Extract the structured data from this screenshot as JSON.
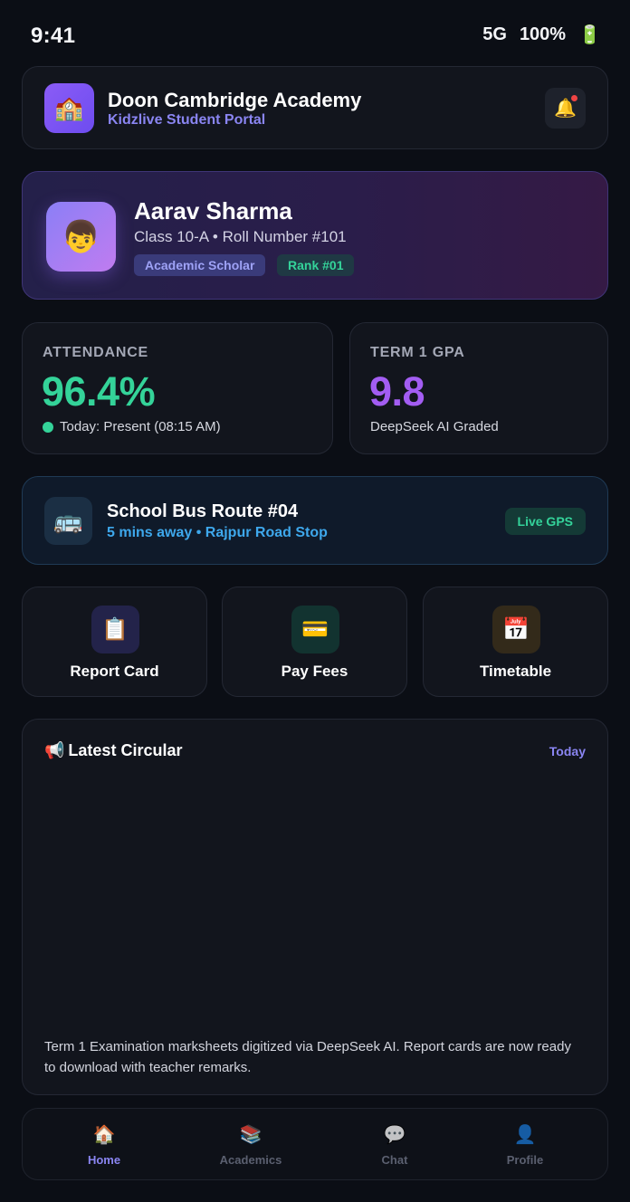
{
  "status_bar": {
    "time": "9:41",
    "network": "5G",
    "battery": "100%",
    "battery_icon": "🔋"
  },
  "header": {
    "logo_icon": "🏫",
    "school_name": "Doon Cambridge Academy",
    "portal_name": "Kidzlive Student Portal",
    "bell_icon": "🔔"
  },
  "profile": {
    "avatar_icon": "👦",
    "name": "Aarav Sharma",
    "class_info": "Class 10-A • Roll Number #101",
    "badges": [
      "Academic Scholar",
      "Rank #01"
    ]
  },
  "stats": {
    "attendance": {
      "label": "ATTENDANCE",
      "value": "96.4%",
      "sub": "Today: Present (08:15 AM)"
    },
    "gpa": {
      "label": "TERM 1 GPA",
      "value": "9.8",
      "sub": "DeepSeek AI Graded"
    }
  },
  "bus": {
    "icon": "🚌",
    "title": "School Bus Route #04",
    "subtitle": "5 mins away • Rajpur Road Stop",
    "badge": "Live GPS"
  },
  "actions": [
    {
      "icon": "📋",
      "label": "Report Card"
    },
    {
      "icon": "💳",
      "label": "Pay Fees"
    },
    {
      "icon": "📅",
      "label": "Timetable"
    }
  ],
  "circular": {
    "icon": "📢",
    "title": "Latest Circular",
    "date": "Today",
    "body": "Term 1 Examination marksheets digitized via DeepSeek AI. Report cards are now ready to download with teacher remarks."
  },
  "nav": {
    "items": [
      {
        "icon": "🏠",
        "label": "Home"
      },
      {
        "icon": "📚",
        "label": "Academics"
      },
      {
        "icon": "💬",
        "label": "Chat"
      },
      {
        "icon": "👤",
        "label": "Profile"
      }
    ],
    "active": "Home"
  },
  "colors": {
    "background": "#0b0e15",
    "accent_purple": "#8a85f2",
    "accent_green": "#34d399",
    "gpa_purple": "#a35df2",
    "bus_blue": "#3ea8ec"
  }
}
